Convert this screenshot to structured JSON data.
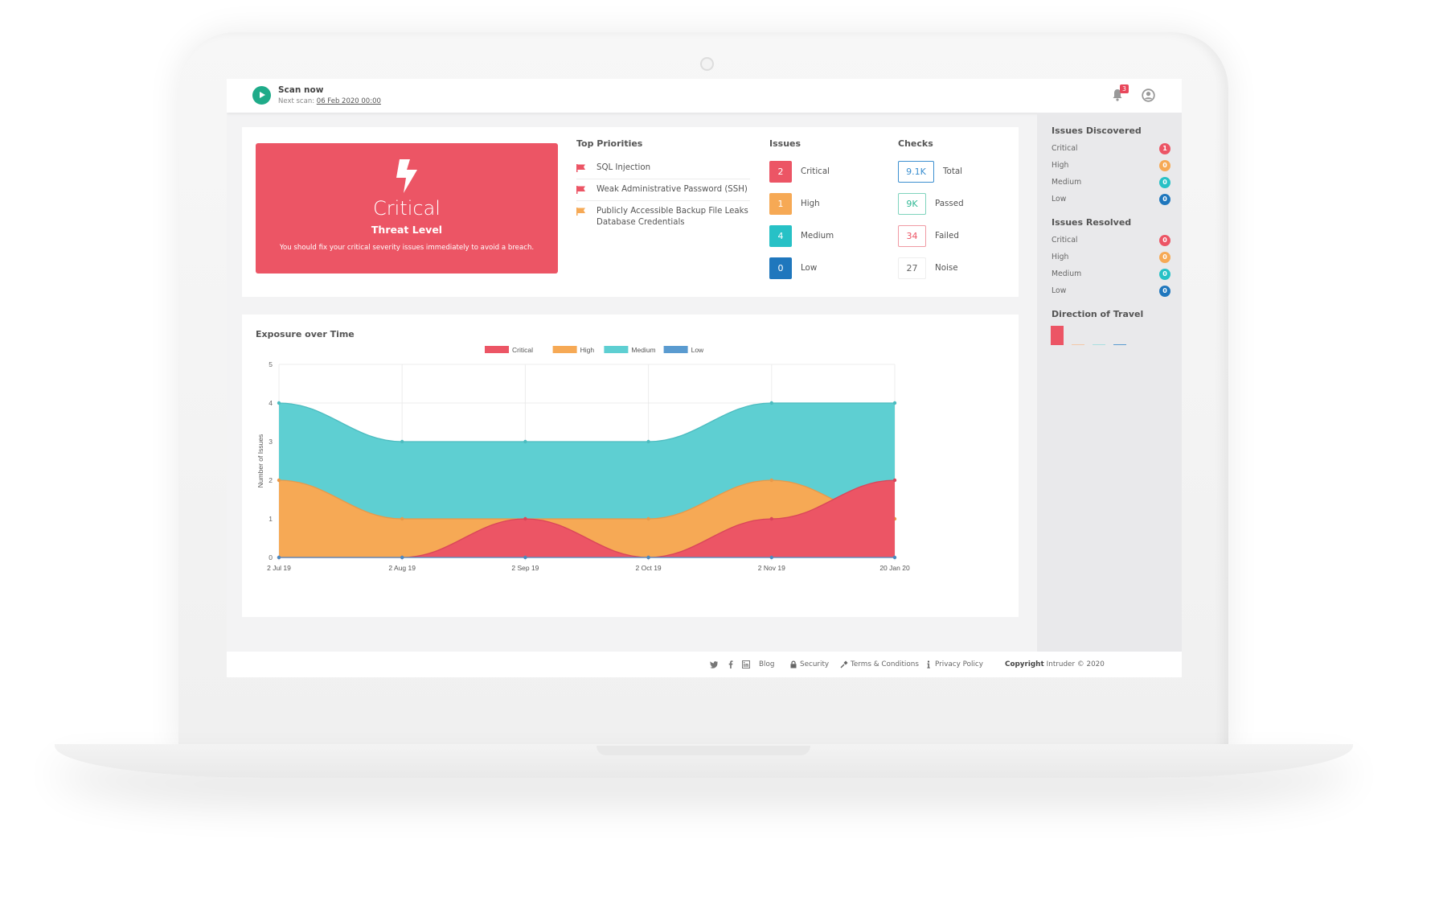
{
  "header": {
    "scan_label": "Scan now",
    "next_scan_prefix": "Next scan: ",
    "next_scan_date": "06 Feb 2020 00:00",
    "notification_count": "3"
  },
  "threat": {
    "level": "Critical",
    "subtitle": "Threat Level",
    "message": "You should fix your critical severity issues immediately to avoid a breach."
  },
  "priorities": {
    "title": "Top Priorities",
    "items": [
      {
        "label": "SQL Injection",
        "severity": "critical"
      },
      {
        "label": "Weak Administrative Password (SSH)",
        "severity": "critical"
      },
      {
        "label": "Publicly Accessible Backup File Leaks Database Credentials",
        "severity": "high"
      }
    ]
  },
  "issues": {
    "title": "Issues",
    "items": [
      {
        "count": "2",
        "label": "Critical"
      },
      {
        "count": "1",
        "label": "High"
      },
      {
        "count": "4",
        "label": "Medium"
      },
      {
        "count": "0",
        "label": "Low"
      }
    ]
  },
  "checks": {
    "title": "Checks",
    "items": [
      {
        "value": "9.1K",
        "label": "Total"
      },
      {
        "value": "9K",
        "label": "Passed"
      },
      {
        "value": "34",
        "label": "Failed"
      },
      {
        "value": "27",
        "label": "Noise"
      }
    ]
  },
  "colors": {
    "critical": "#ec5565",
    "high": "#f6a955",
    "medium": "#5ecfd2",
    "low": "#5a9bd0",
    "low_badge": "#1f77bd",
    "brand": "#1fab89",
    "passed": "#2fb894",
    "total": "#3b8fd0"
  },
  "sidebar": {
    "discovered_title": "Issues Discovered",
    "discovered": [
      {
        "label": "Critical",
        "count": "1"
      },
      {
        "label": "High",
        "count": "0"
      },
      {
        "label": "Medium",
        "count": "0"
      },
      {
        "label": "Low",
        "count": "0"
      }
    ],
    "resolved_title": "Issues Resolved",
    "resolved": [
      {
        "label": "Critical",
        "count": "0"
      },
      {
        "label": "High",
        "count": "0"
      },
      {
        "label": "Medium",
        "count": "0"
      },
      {
        "label": "Low",
        "count": "0"
      }
    ],
    "direction_title": "Direction of Travel",
    "direction_values": [
      1,
      0,
      0,
      0
    ]
  },
  "footer": {
    "blog": "Blog",
    "security": "Security",
    "terms": "Terms & Conditions",
    "privacy": "Privacy Policy",
    "copyright_bold": "Copyright",
    "copyright_rest": " Intruder © 2020"
  },
  "chart_data": {
    "type": "area",
    "title": "Exposure over Time",
    "xlabel": "",
    "ylabel": "Number of Issues",
    "categories": [
      "2 Jul 19",
      "2 Aug 19",
      "2 Sep 19",
      "2 Oct 19",
      "2 Nov 19",
      "20 Jan 20"
    ],
    "ylim": [
      0,
      5
    ],
    "yticks": [
      0,
      1,
      2,
      3,
      4,
      5
    ],
    "grid": true,
    "legend": "top-center",
    "series": [
      {
        "name": "Critical",
        "values": [
          0,
          0,
          1,
          0,
          1,
          2
        ]
      },
      {
        "name": "High",
        "values": [
          2,
          1,
          1,
          1,
          2,
          1
        ]
      },
      {
        "name": "Medium",
        "values": [
          4,
          3,
          3,
          3,
          4,
          4
        ]
      },
      {
        "name": "Low",
        "values": [
          0,
          0,
          0,
          0,
          0,
          0
        ]
      }
    ]
  }
}
